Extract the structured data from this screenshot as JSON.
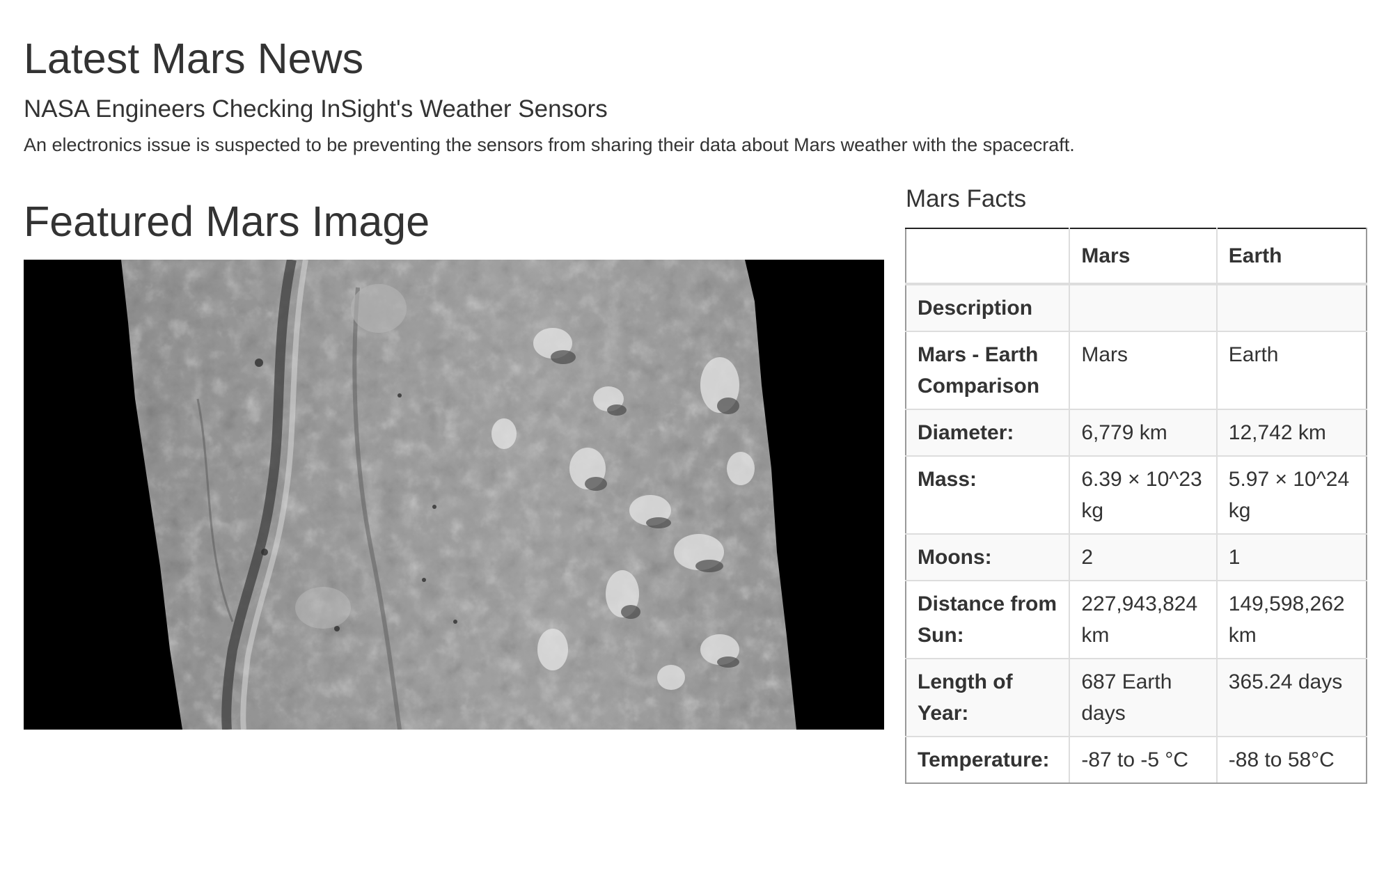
{
  "news": {
    "heading": "Latest Mars News",
    "title": "NASA Engineers Checking InSight's Weather Sensors",
    "teaser": "An electronics issue is suspected to be preventing the sensors from sharing their data about Mars weather with the spacecraft."
  },
  "featured": {
    "heading": "Featured Mars Image"
  },
  "facts": {
    "heading": "Mars Facts",
    "columns": [
      "",
      "Mars",
      "Earth"
    ],
    "rows": [
      {
        "label": "Description",
        "mars": "",
        "earth": ""
      },
      {
        "label": "Mars - Earth Comparison",
        "mars": "Mars",
        "earth": "Earth"
      },
      {
        "label": "Diameter:",
        "mars": "6,779 km",
        "earth": "12,742 km"
      },
      {
        "label": "Mass:",
        "mars": "6.39 × 10^23 kg",
        "earth": "5.97 × 10^24 kg"
      },
      {
        "label": "Moons:",
        "mars": "2",
        "earth": "1"
      },
      {
        "label": "Distance from Sun:",
        "mars": "227,943,824 km",
        "earth": "149,598,262 km"
      },
      {
        "label": "Length of Year:",
        "mars": "687 Earth days",
        "earth": "365.24 days"
      },
      {
        "label": "Temperature:",
        "mars": "-87 to -5 °C",
        "earth": "-88 to 58°C"
      }
    ]
  }
}
